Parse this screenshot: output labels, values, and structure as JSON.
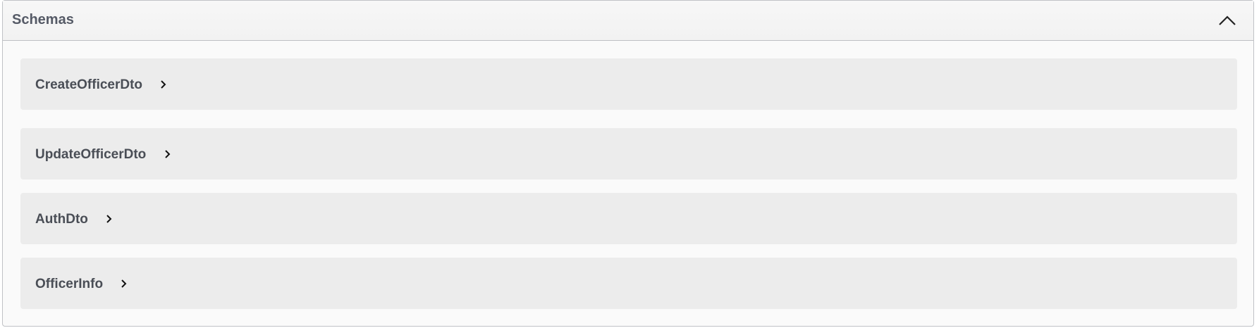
{
  "section": {
    "title": "Schemas",
    "collapse_icon": "chevron-up-icon"
  },
  "schemas": [
    {
      "name": "CreateOfficerDto",
      "icon": "chevron-right-icon"
    },
    {
      "name": "UpdateOfficerDto",
      "icon": "chevron-right-icon"
    },
    {
      "name": "AuthDto",
      "icon": "chevron-right-icon"
    },
    {
      "name": "OfficerInfo",
      "icon": "chevron-right-icon"
    }
  ],
  "colors": {
    "panel_bg": "#fafafa",
    "item_bg": "#ececec",
    "text": "#4a4e56"
  }
}
